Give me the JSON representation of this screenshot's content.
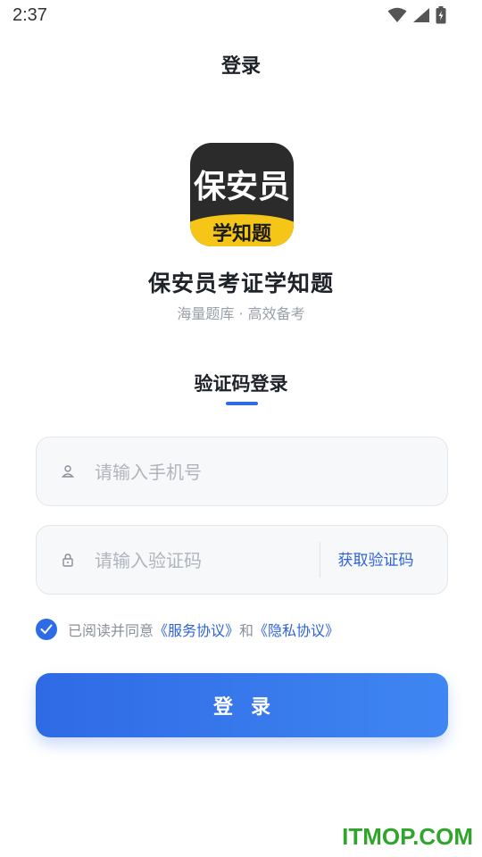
{
  "status_bar": {
    "time": "2:37",
    "icons": [
      "wifi-icon",
      "signal-icon",
      "battery-charging-icon"
    ]
  },
  "nav": {
    "title": "登录"
  },
  "app": {
    "icon_text_top": "保安员",
    "icon_text_bottom": "学知题",
    "name": "保安员考证学知题",
    "slogan": "海量题库 · 高效备考"
  },
  "login_tab": {
    "label": "验证码登录",
    "accent": "#2e6be6"
  },
  "form": {
    "phone": {
      "value": "",
      "placeholder": "请输入手机号",
      "icon": "person-icon"
    },
    "code": {
      "value": "",
      "placeholder": "请输入验证码",
      "icon": "lock-icon",
      "get_code_label": "获取验证码"
    }
  },
  "agreement": {
    "checked": true,
    "prefix": "已阅读并同意",
    "service_link": "《服务协议》",
    "conjunction": "和",
    "privacy_link": "《隐私协议》"
  },
  "login_button": {
    "label": "登录"
  },
  "watermark": {
    "text": "ITMOP.COM",
    "color": "#2fa52b"
  },
  "colors": {
    "primary": "#2e6be6",
    "link": "#2e63d8",
    "icon_yellow": "#f5c518"
  }
}
